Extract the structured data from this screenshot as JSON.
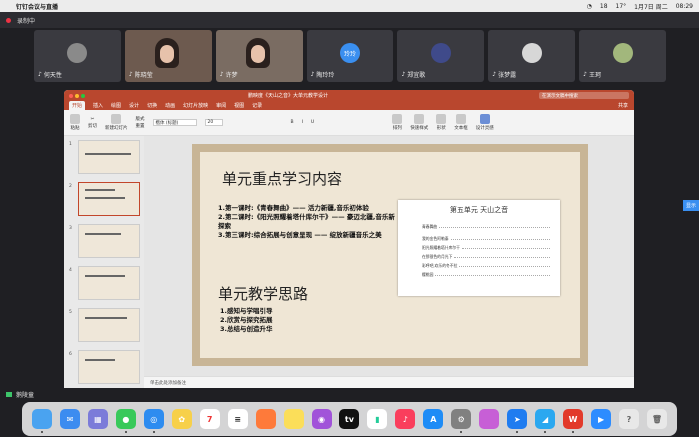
{
  "menubar": {
    "app_name": "钉钉会议与直播",
    "status_items": [
      "18",
      "17°",
      "08:29",
      "1月7日 周二"
    ]
  },
  "meeting": {
    "recording_label": "录制中",
    "mute_name": "鹅陵童"
  },
  "participants": [
    {
      "name": "何天性",
      "type": "avatar"
    },
    {
      "name": "陈晓莹",
      "type": "cam"
    },
    {
      "name": "许梦",
      "type": "cam"
    },
    {
      "name": "陶玲玲",
      "type": "initial",
      "initial": "玲玲"
    },
    {
      "name": "郑宜歌",
      "type": "avatar"
    },
    {
      "name": "张梦露",
      "type": "avatar"
    },
    {
      "name": "王珂",
      "type": "avatar"
    }
  ],
  "ppt": {
    "doc_title": "鹏映度《天山之音》大单元教学设计",
    "search_placeholder": "在演示文稿中搜索",
    "tabs": [
      "开始",
      "插入",
      "绘图",
      "设计",
      "切换",
      "动画",
      "幻灯片放映",
      "审阅",
      "视图",
      "记录"
    ],
    "share_label": "共享",
    "ribbon": [
      "粘贴",
      "剪切",
      "复制",
      "格式",
      "新建幻灯片",
      "版式",
      "重置",
      "节",
      "排列",
      "快速样式",
      "形状",
      "文本框",
      "设计灵感"
    ],
    "font_name": "楷体 (标题)",
    "font_size": "20",
    "slide": {
      "title1": "单元重点学习内容",
      "points": [
        "1.第一课时:《青春舞曲》—— 活力新疆,音乐初体验",
        "2.第二课时:《阳光照耀着塔什库尔干》—— 豪迈北疆,音乐新探索",
        "3.第三课时:综合拓展与创意呈现 —— 绽放新疆音乐之美"
      ],
      "title2": "单元教学思路",
      "points2": [
        "1.感知与学唱引导",
        "2.欣赏与探究拓展",
        "3.总结与创造升华"
      ],
      "toc_title": "第五单元    天山之音",
      "toc_items": [
        "青春舞曲",
        "我的金色阿勒泰",
        "阳光照耀着塔什库尔干",
        "在那银色的月光下",
        "彩呼吧,欢乐的冬不拉",
        "樱桃园"
      ]
    },
    "notes_placeholder": "单击此处添加备注",
    "status": {
      "slide_info": "幻灯片 2 / 8",
      "language": "中文(中国)",
      "zoom": "100%"
    }
  },
  "dock": [
    "Finder",
    "Mail",
    "Launchpad",
    "Messages",
    "Safari",
    "Photos",
    "Notes",
    "Calendar",
    "Reminders",
    "Music",
    "App Store",
    "Settings",
    "TV",
    "Podcasts",
    "Numbers",
    "Keynote",
    "Word",
    "PowerPoint",
    "WPS",
    "Zoom",
    "Trash"
  ],
  "side_button": "显示"
}
